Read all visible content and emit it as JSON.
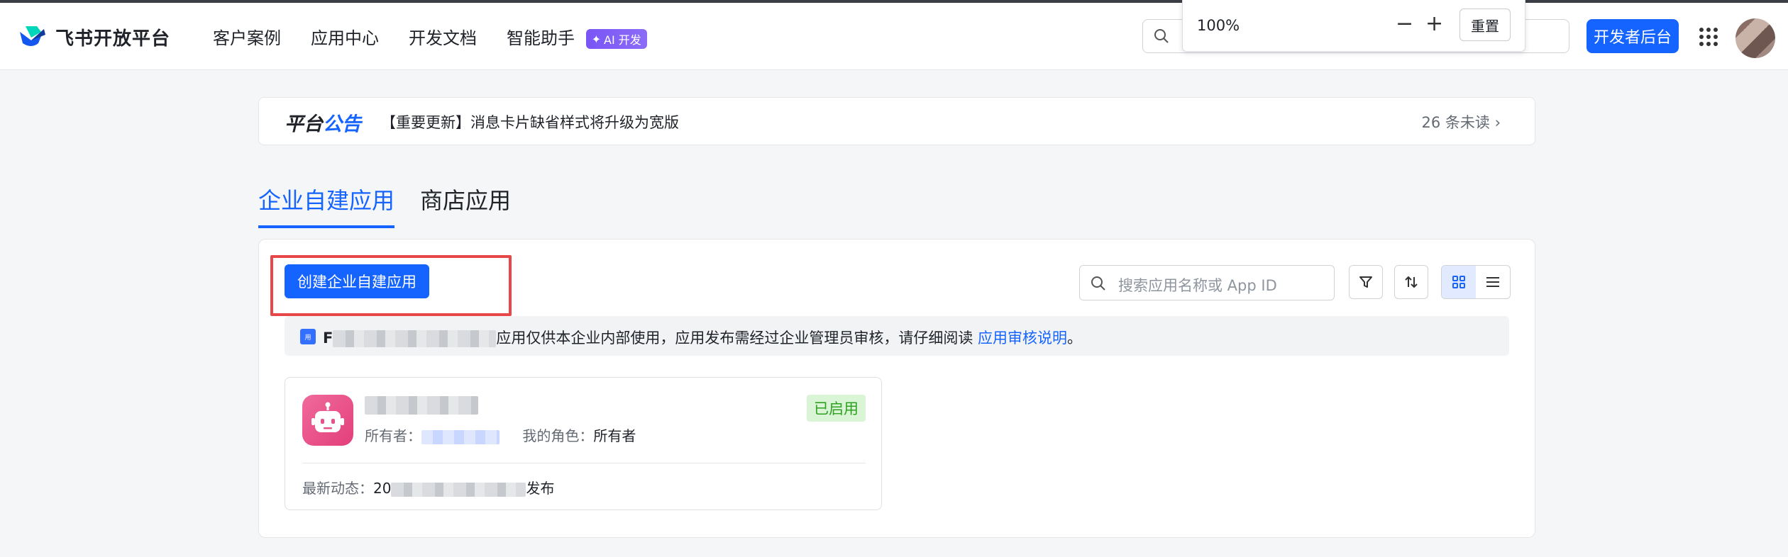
{
  "header": {
    "logo_text": "飞书开放平台",
    "nav": [
      "客户案例",
      "应用中心",
      "开发文档",
      "智能助手"
    ],
    "ai_badge": "AI 开发",
    "dev_console_button": "开发者后台"
  },
  "zoom_popup": {
    "value": "100%",
    "minus": "−",
    "plus": "+",
    "reset": "重置"
  },
  "notice": {
    "title_a": "平台",
    "title_b": "公告",
    "text": "【重要更新】消息卡片缺省样式将升级为宽版",
    "unread": "26 条未读",
    "chevron": "›"
  },
  "tabs": [
    "企业自建应用",
    "商店应用"
  ],
  "toolbar": {
    "create_button": "创建企业自建应用",
    "search_placeholder": "搜索应用名称或 App ID"
  },
  "info_bar": {
    "badge": "用",
    "lead": "F",
    "text": "应用仅供本企业内部使用，应用发布需经过企业管理员审核，请仔细阅读",
    "link": "应用审核说明",
    "tail": "。"
  },
  "app_card": {
    "status": "已启用",
    "owner_label": "所有者：",
    "role_label": "我的角色：",
    "role_value": "所有者",
    "activity_label": "最新动态：",
    "activity_prefix": "20",
    "activity_suffix": "发布"
  },
  "colors": {
    "primary": "#1664ff",
    "highlight_border": "#e8474a",
    "status_green": "#2ea121",
    "app_icon": "#e8508a"
  }
}
